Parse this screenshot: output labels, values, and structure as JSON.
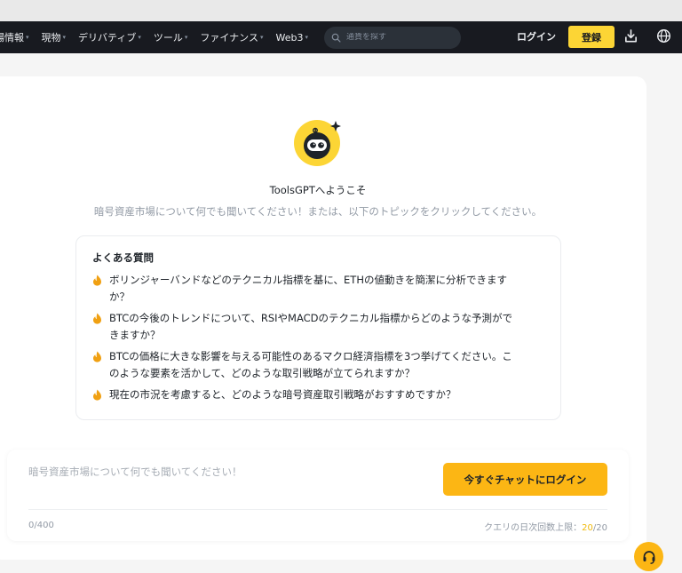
{
  "nav": {
    "items": [
      {
        "label": "場情報",
        "caret": "▾"
      },
      {
        "label": "現物",
        "caret": "▾"
      },
      {
        "label": "デリバティブ",
        "caret": "▾"
      },
      {
        "label": "ツール",
        "caret": "▾"
      },
      {
        "label": "ファイナンス",
        "caret": "▾"
      },
      {
        "label": "Web3",
        "caret": "▾"
      }
    ],
    "search_placeholder": "通貨を探す",
    "login": "ログイン",
    "signup": "登録"
  },
  "main": {
    "welcome": "ToolsGPTへようこそ",
    "subtitle": "暗号資産市場について何でも聞いてください！または、以下のトピックをクリックしてください。"
  },
  "faq": {
    "title": "よくある質問",
    "items": [
      {
        "line1": "ボリンジャーバンドなどのテクニカル指標を基に、ETHの値動きを簡潔に分析できます",
        "line2": "か？"
      },
      {
        "line1": "BTCの今後のトレンドについて、RSIやMACDのテクニカル指標からどのような予測がで",
        "line2": "きますか？"
      },
      {
        "line1": "BTCの価格に大きな影響を与える可能性のあるマクロ経済指標を3つ挙げてください。こ",
        "line2": "のような要素を活かして、どのような取引戦略が立てられますか？"
      },
      {
        "line1": "現在の市況を考慮すると、どのような暗号資産取引戦略がおすすめですか？",
        "line2": ""
      }
    ]
  },
  "chat": {
    "placeholder": "暗号資産市場について何でも聞いてください！",
    "login_button": "今すぐチャットにログイン",
    "counter": "0/400",
    "quota_label": "クエリの日次回数上限：",
    "quota_used": "20",
    "quota_total": "/20"
  },
  "colors": {
    "nav_bg": "#181a20",
    "accent": "#fcd535",
    "button": "#fcb614",
    "quota_highlight": "#f0b90b"
  }
}
